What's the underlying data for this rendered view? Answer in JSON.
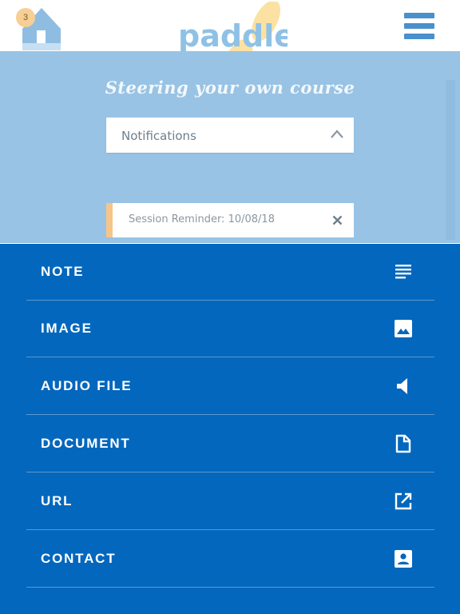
{
  "header": {
    "home_badge_count": "3",
    "logo_text": "paddle",
    "tagline": "Steering your own course"
  },
  "notifications": {
    "dropdown_label": "Notifications",
    "items": [
      {
        "label": "Session Reminder: 10/08/18"
      }
    ]
  },
  "sheet": {
    "items": [
      {
        "label": "NOTE",
        "icon": "note-lines-icon"
      },
      {
        "label": "IMAGE",
        "icon": "image-icon"
      },
      {
        "label": "AUDIO FILE",
        "icon": "speaker-icon"
      },
      {
        "label": "DOCUMENT",
        "icon": "document-icon"
      },
      {
        "label": "URL",
        "icon": "external-link-icon"
      },
      {
        "label": "CONTACT",
        "icon": "contact-card-icon"
      }
    ]
  },
  "colors": {
    "accent_blue": "#0367bd",
    "hero_blue": "#98c3e4",
    "logo_blue": "#8fc1e6",
    "reminder_accent": "#f7c489"
  }
}
